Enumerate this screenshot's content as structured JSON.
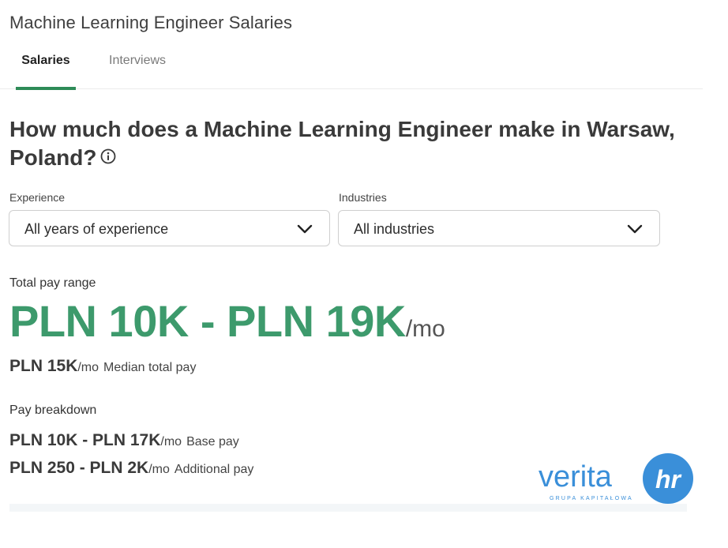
{
  "page_title": "Machine Learning Engineer Salaries",
  "tabs": [
    {
      "label": "Salaries",
      "active": true
    },
    {
      "label": "Interviews",
      "active": false
    }
  ],
  "question": "How much does a Machine Learning Engineer make in Warsaw, Poland?",
  "filters": {
    "experience": {
      "label": "Experience",
      "value": "All years of experience"
    },
    "industries": {
      "label": "Industries",
      "value": "All industries"
    }
  },
  "total_pay": {
    "label": "Total pay range",
    "range": "PLN 10K - PLN 19K",
    "unit": "/mo",
    "median_value": "PLN 15K",
    "median_unit": "/mo",
    "median_label": "Median total pay"
  },
  "breakdown": {
    "label": "Pay breakdown",
    "rows": [
      {
        "value": "PLN 10K - PLN 17K",
        "unit": "/mo",
        "label": "Base pay"
      },
      {
        "value": "PLN 250 - PLN 2K",
        "unit": "/mo",
        "label": "Additional pay"
      }
    ]
  },
  "watermark": {
    "text": "verita",
    "badge": "hr",
    "tagline": "GRUPA KAPITAŁOWA"
  },
  "colors": {
    "accent_green": "#3d9a6c",
    "tab_underline": "#2e8b57",
    "logo_blue": "#3a8fd9"
  }
}
